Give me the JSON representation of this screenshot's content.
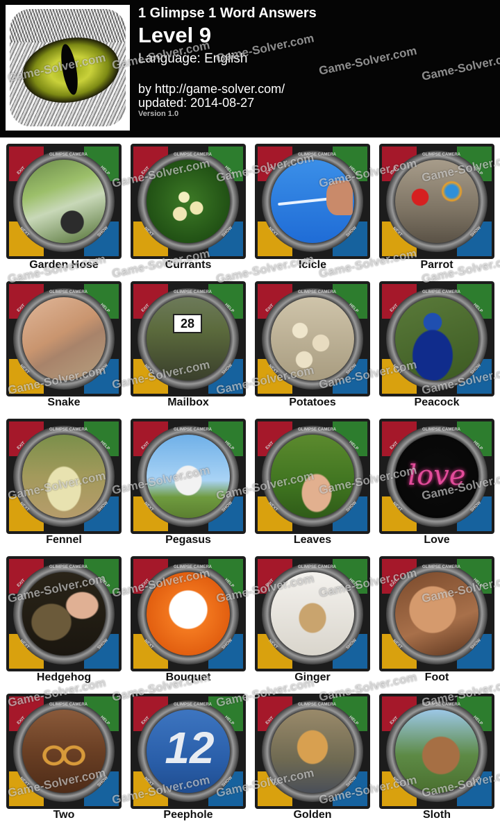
{
  "header": {
    "title": "1 Glimpse 1 Word Answers",
    "level": "Level 9",
    "language": "Language: English",
    "by": "by http://game-solver.com/",
    "updated": "updated: 2014-08-27",
    "version": "Version 1.0"
  },
  "ring_labels": {
    "top": "GLIMPSE CAMERA",
    "left": "EXIT",
    "right": "HELP",
    "bottom_left": "NEXT",
    "bottom_right": "SHOW"
  },
  "watermark": "Game-Solver.com",
  "colors": {
    "red": "#a5182a",
    "green": "#2d7d2e",
    "yellow": "#d9a10e",
    "blue": "#16629e"
  },
  "answers": [
    "Garden Hose",
    "Currants",
    "Icicle",
    "Parrot",
    "Snake",
    "Mailbox",
    "Potatoes",
    "Peacock",
    "Fennel",
    "Pegasus",
    "Leaves",
    "Love",
    "Hedgehog",
    "Bouquet",
    "Ginger",
    "Foot",
    "Two",
    "Peephole",
    "Golden",
    "Sloth"
  ],
  "photos": [
    "garden-hose",
    "currants",
    "icicle",
    "parrot",
    "snake",
    "mailbox",
    "potatoes",
    "peacock",
    "fennel",
    "pegasus",
    "leaves",
    "love",
    "hedgehog",
    "bouquet",
    "ginger",
    "foot",
    "two",
    "peephole",
    "golden",
    "sloth"
  ],
  "overlays": {
    "mailbox_number": "28",
    "peephole_number": "12",
    "love_text": "love"
  }
}
